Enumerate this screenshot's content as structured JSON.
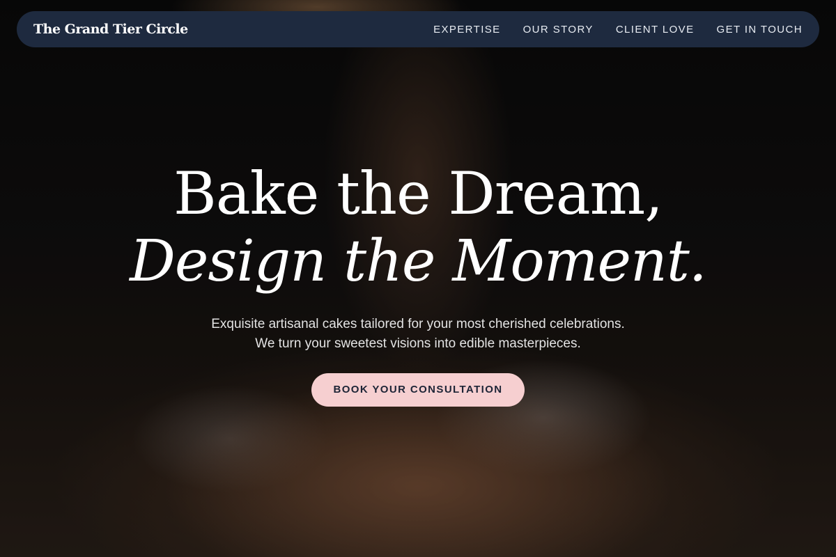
{
  "nav": {
    "brand": "The Grand Tier Circle",
    "links": [
      "EXPERTISE",
      "OUR STORY",
      "CLIENT LOVE",
      "GET IN TOUCH"
    ]
  },
  "hero": {
    "headline_line1": "Bake the Dream,",
    "headline_line2": "Design the Moment.",
    "subtitle_line1": "Exquisite artisanal cakes tailored for your most cherished celebrations.",
    "subtitle_line2": "We turn your sweetest visions into edible masterpieces.",
    "cta_label": "BOOK YOUR CONSULTATION"
  },
  "colors": {
    "nav_background": "#1e2a3f",
    "cta_background": "#f6cfd0",
    "cta_text": "#1d2436"
  }
}
